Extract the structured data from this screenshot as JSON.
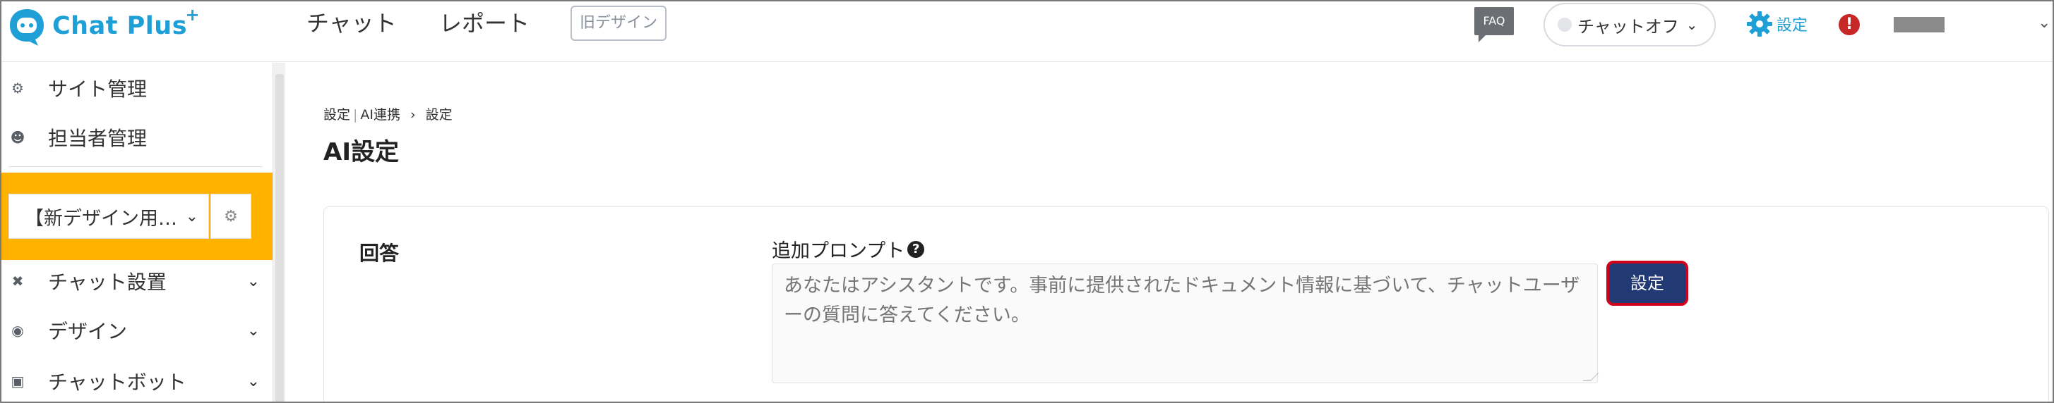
{
  "header": {
    "logo_text": "Chat Plus",
    "logo_sup": "+",
    "nav": [
      "チャット",
      "レポート"
    ],
    "old_design_label": "旧デザイン",
    "faq_label": "FAQ",
    "chat_status": "チャットオフ",
    "settings_label": "設定",
    "alert_symbol": "!",
    "accent_color": "#1e9fd6"
  },
  "sidebar": {
    "items_top": [
      {
        "label": "サイト管理",
        "icon": "gear-icon"
      },
      {
        "label": "担当者管理",
        "icon": "users-icon"
      }
    ],
    "site_select": {
      "value": "【新デザイン用…",
      "highlight_color": "#ffb300"
    },
    "items_bottom": [
      {
        "label": "チャット設置",
        "icon": "tools-icon"
      },
      {
        "label": "デザイン",
        "icon": "palette-icon"
      },
      {
        "label": "チャットボット",
        "icon": "chat-icon"
      }
    ]
  },
  "main": {
    "breadcrumb": {
      "part1": "設定",
      "part2": "AI連携",
      "part3": "設定"
    },
    "title": "AI設定",
    "section_label": "回答",
    "field_label": "追加プロンプト",
    "textarea_placeholder": "あなたはアシスタントです。事前に提供されたドキュメント情報に基づいて、チャットユーザーの質問に答えてください。",
    "save_button": "設定",
    "save_button_color": "#213a74"
  }
}
